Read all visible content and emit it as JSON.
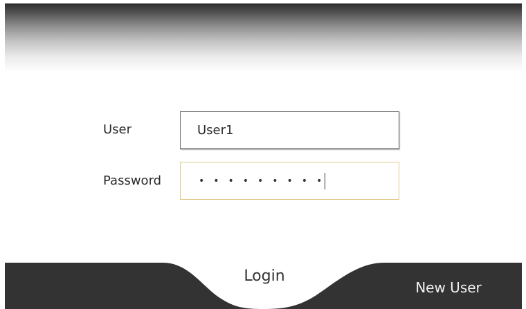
{
  "form": {
    "user_label": "User",
    "user_value": "User1",
    "password_label": "Password",
    "password_mask": "•••••••••",
    "password_focused": true
  },
  "footer": {
    "login_label": "Login",
    "new_user_label": "New User",
    "active_tab": "Login"
  },
  "colors": {
    "footer_dark": "#333333",
    "focus_border": "#e0c887",
    "background": "#ffffff"
  }
}
